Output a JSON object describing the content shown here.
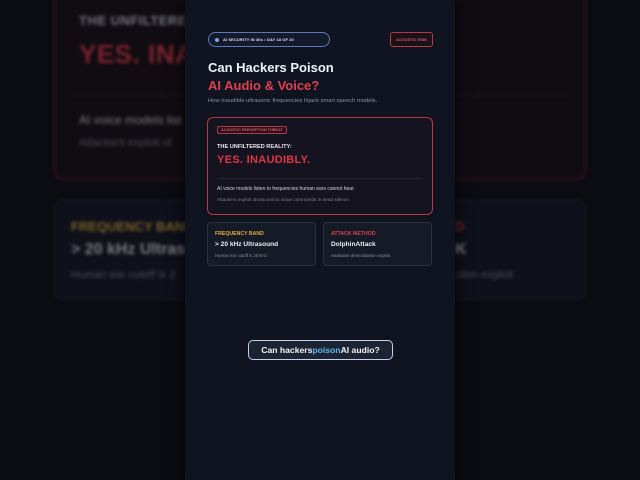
{
  "background": {
    "unfiltered_label": "THE UNFILTERED",
    "answer_fragment": "YES. INA",
    "voice_line_fragment": "AI voice models list",
    "attack_line_fragment": "Attackers exploit ul",
    "freq_label_fragment": "FREQUENCY BAND",
    "freq_value_fragment": "> 20 kHz Ultrasou",
    "freq_desc_fragment": "Human ear cutoff is 2",
    "attack_label_fragment": "D",
    "attack_value_fragment": "K",
    "attack_desc_fragment": "ction exploit"
  },
  "header": {
    "series_label": "AI SECURITY IN 30s • DAY 18 OF 20",
    "risk_badge": "ACOUSTIC RISK"
  },
  "headline": {
    "line1": "Can Hackers Poison",
    "line2": "AI Audio & Voice?",
    "subtitle": "How inaudible ultrasonic frequencies hijack smart speech models."
  },
  "threat_card": {
    "tag": "ACOUSTIC PERCEPTION THREAT",
    "question": "THE UNFILTERED REALITY:",
    "answer": "YES. INAUDIBLY.",
    "line1": "AI voice models listen to frequencies human ears cannot hear.",
    "line2": "Attackers exploit ultrasound to issue commands in dead silence."
  },
  "info_cards": [
    {
      "label": "FREQUENCY BAND",
      "label_color": "#e6a93c",
      "value": "> 20 kHz Ultrasound",
      "desc": "Human ear cutoff is 20 kHz"
    },
    {
      "label": "ATTACK METHOD",
      "label_color": "#e0404f",
      "value": "DolphinAttack",
      "desc": "Hardware demodulation exploit"
    }
  ],
  "caption": {
    "before": "Can hackers ",
    "highlight": "poison",
    "after": " AI audio?"
  },
  "colors": {
    "accent_red": "#e0404f",
    "accent_amber": "#e6a93c",
    "accent_blue": "#5fb6f2",
    "panel_bg": "#0f1420"
  }
}
